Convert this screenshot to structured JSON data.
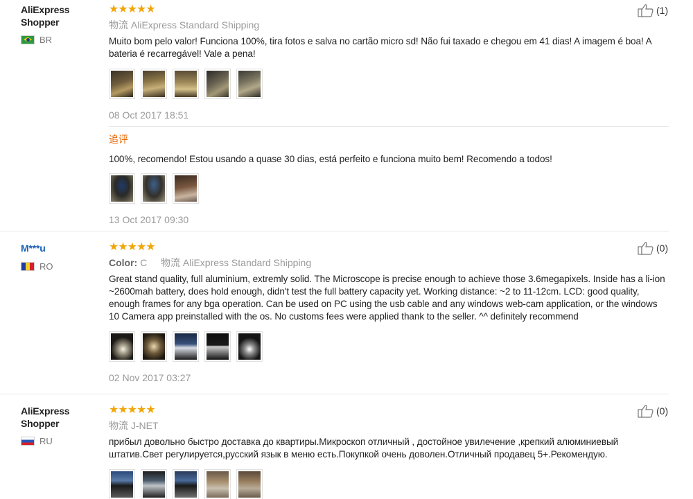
{
  "reviews": [
    {
      "buyer": "AliExpress\nShopper",
      "buyer_line1": "AliExpress",
      "buyer_line2": "Shopper",
      "country": "BR",
      "stars": "★★★★★",
      "logistics_label": "物流",
      "logistics": "AliExpress Standard Shipping",
      "text": "Muito bom pelo valor! Funciona 100%, tira fotos e salva no cartão micro sd! Não fui taxado e chegou em 41 dias! A imagem é boa! A bateria é recarregável! Vale a pena!",
      "date": "08 Oct 2017 18:51",
      "likes": "(1)",
      "followup": {
        "label": "追评",
        "text": "100%, recomendo! Estou usando a quase 30 dias, está perfeito e funciona muito bem! Recomendo a todos!",
        "date": "13 Oct 2017 09:30"
      }
    },
    {
      "buyer": "M***u",
      "country": "RO",
      "stars": "★★★★★",
      "color_label": "Color:",
      "color_value": "C",
      "logistics_label": "物流",
      "logistics": "AliExpress Standard Shipping",
      "text": "Great stand quality, full aluminium, extremly solid. The Microscope is precise enough to achieve those 3.6megapixels. Inside has a li-ion ~2600mah battery, does hold enough, didn't test the full battery capacity yet. Working distance: ~2 to 11-12cm. LCD: good quality, enough frames for any bga operation. Can be used on PC using the usb cable and any windows web-cam application, or the windows 10 Camera app preinstalled with the os. No customs fees were applied thank to the seller. ^^ definitely recommend",
      "date": "02 Nov 2017 03:27",
      "likes": "(0)"
    },
    {
      "buyer_line1": "AliExpress",
      "buyer_line2": "Shopper",
      "country": "RU",
      "stars": "★★★★★",
      "logistics_label": "物流",
      "logistics": "J-NET",
      "text": "прибыл довольно быстро доставка до квартиры.Микроскоп отличный , достойное увилечение ,крепкий алюминиевый штатив.Свет регулируется,русский язык в меню есть.Покупкой очень доволен.Отличный продавец 5+.Рекомендую.",
      "likes": "(0)"
    }
  ],
  "colors": {
    "star": "#f0a60a",
    "followup_label": "#e56600",
    "buyer_link": "#1a5fb4",
    "muted": "#999999"
  },
  "icons": {
    "like": "thumbs-up-icon"
  }
}
